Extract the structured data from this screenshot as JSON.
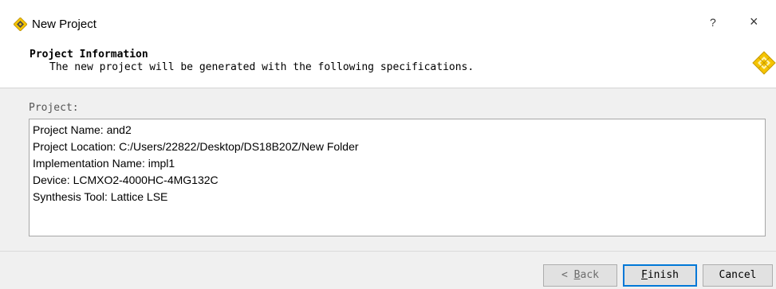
{
  "window": {
    "title": "New Project",
    "help_label": "?",
    "close_label": "×"
  },
  "header": {
    "title": "Project Information",
    "description": "The new project will be generated with the following specifications."
  },
  "summary": {
    "label": "Project:",
    "lines": [
      "Project Name: and2",
      "Project Location: C:/Users/22822/Desktop/DS18B20Z/New Folder",
      "Implementation Name: impl1",
      "Device: LCMXO2-4000HC-4MG132C",
      "Synthesis Tool: Lattice LSE"
    ]
  },
  "buttons": {
    "back_prefix": "< ",
    "back_mnemonic": "B",
    "back_rest": "ack",
    "finish_mnemonic": "F",
    "finish_rest": "inish",
    "cancel_label": "Cancel"
  },
  "colors": {
    "accent": "#0078d7",
    "dialog_bg": "#f0f0f0",
    "logo_gold": "#f5c400"
  },
  "icons": {
    "app": "lattice-diamond-icon",
    "header_logo": "lattice-logo-icon"
  }
}
